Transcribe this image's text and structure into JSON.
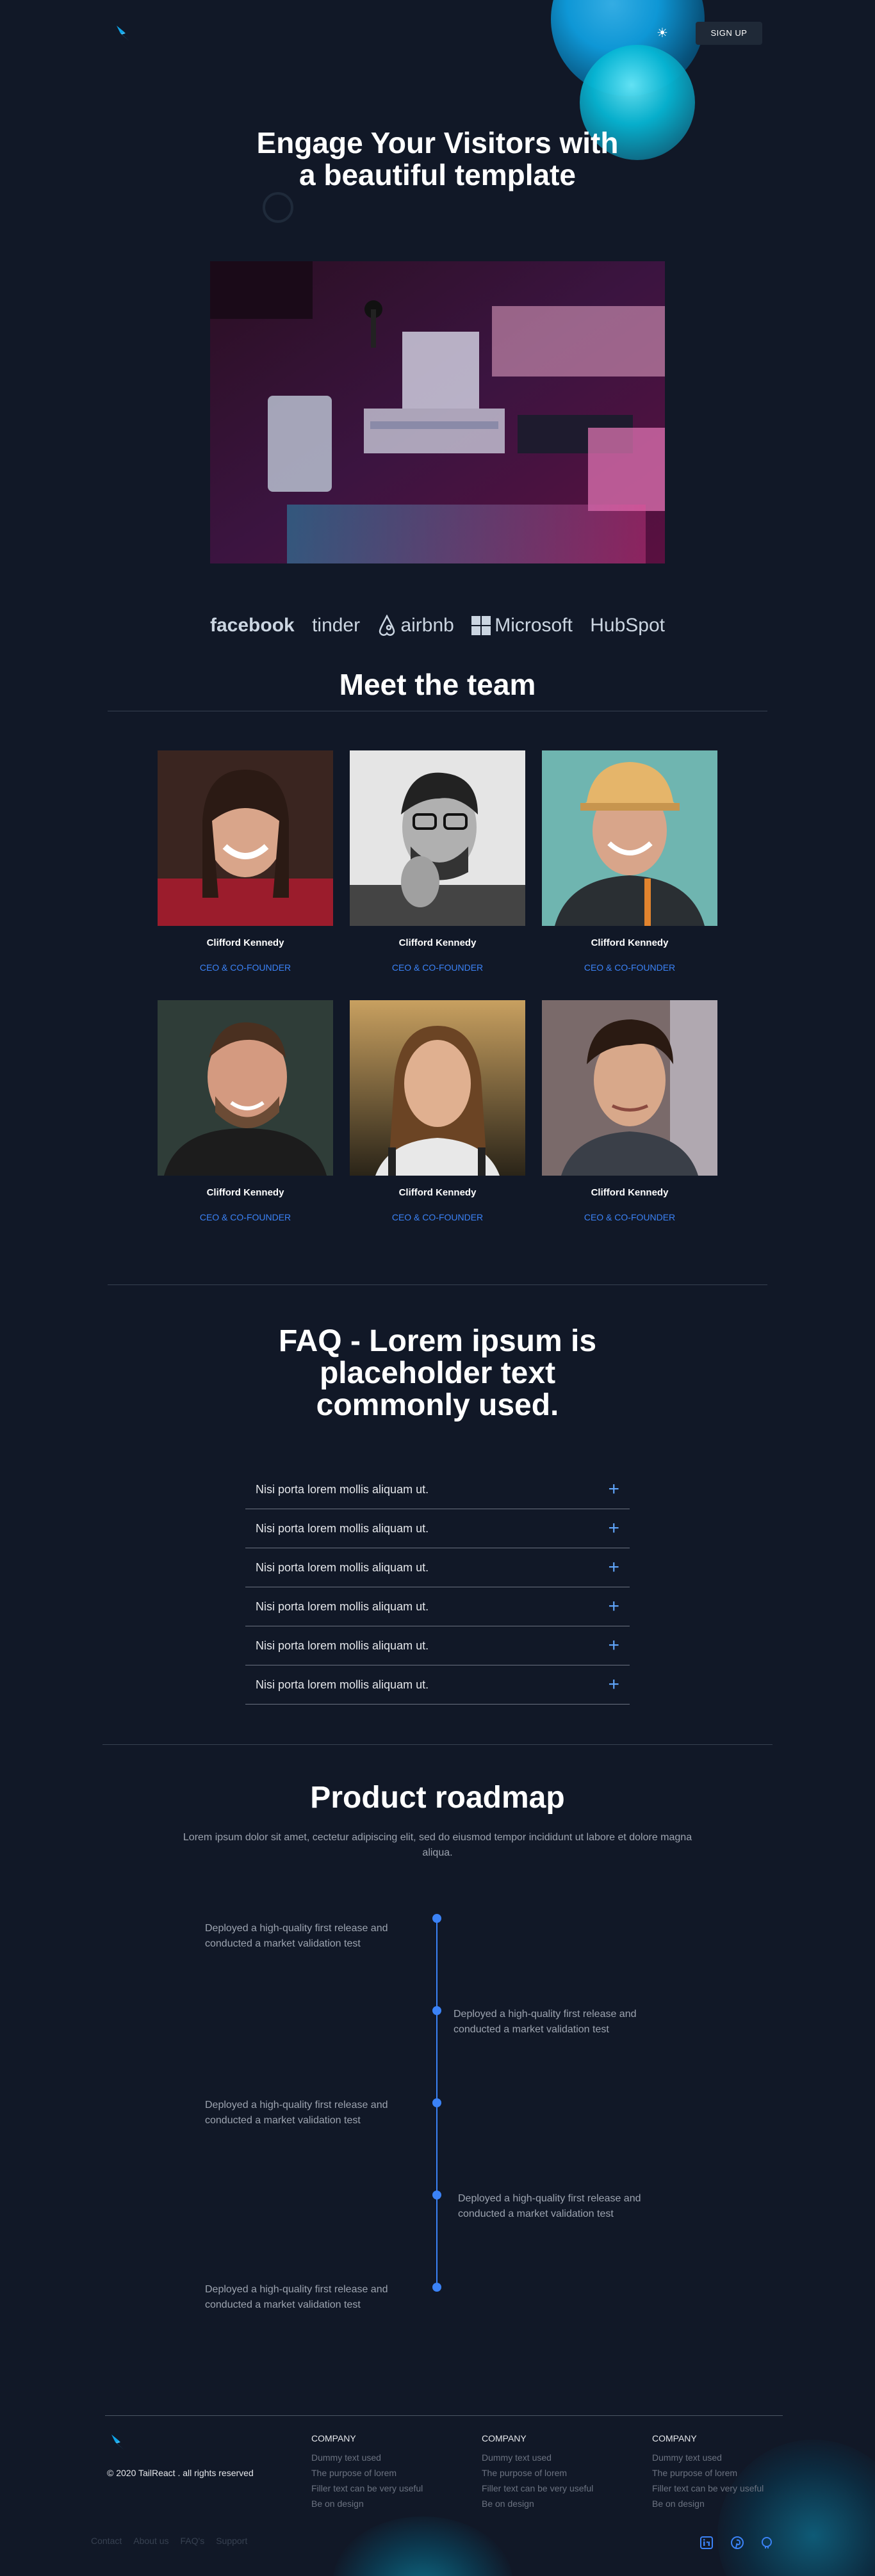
{
  "header": {
    "signup_label": "SIGN UP",
    "theme_icon": "sun-icon"
  },
  "hero": {
    "title": "Engage Your Visitors with a beautiful template"
  },
  "logos": [
    "facebook",
    "tinder",
    "airbnb",
    "Microsoft",
    "HubSpot"
  ],
  "team": {
    "title": "Meet the team",
    "members": [
      {
        "name": "Clifford Kennedy",
        "role": "CEO & CO-FOUNDER"
      },
      {
        "name": "Clifford Kennedy",
        "role": "CEO & CO-FOUNDER"
      },
      {
        "name": "Clifford Kennedy",
        "role": "CEO & CO-FOUNDER"
      },
      {
        "name": "Clifford Kennedy",
        "role": "CEO & CO-FOUNDER"
      },
      {
        "name": "Clifford Kennedy",
        "role": "CEO & CO-FOUNDER"
      },
      {
        "name": "Clifford Kennedy",
        "role": "CEO & CO-FOUNDER"
      }
    ]
  },
  "faq": {
    "title": "FAQ - Lorem ipsum is placeholder text commonly used.",
    "items": [
      "Nisi porta lorem mollis aliquam ut.",
      "Nisi porta lorem mollis aliquam ut.",
      "Nisi porta lorem mollis aliquam ut.",
      "Nisi porta lorem mollis aliquam ut.",
      "Nisi porta lorem mollis aliquam ut.",
      "Nisi porta lorem mollis aliquam ut."
    ]
  },
  "roadmap": {
    "title": "Product roadmap",
    "subtitle": "Lorem ipsum dolor sit amet, cectetur adipiscing elit, sed do eiusmod tempor incididunt ut labore et dolore magna aliqua.",
    "items": [
      "Deployed a high-quality first release and conducted a market validation test",
      "Deployed a high-quality first release and conducted a market validation test",
      "Deployed a high-quality first release and conducted a market validation test",
      "Deployed a high-quality first release and conducted a market validation test",
      "Deployed a high-quality first release and conducted a market validation test"
    ]
  },
  "footer": {
    "copyright": "© 2020 TailReact . all rights reserved",
    "columns": [
      {
        "heading": "COMPANY",
        "links": [
          "Dummy text used",
          "The purpose of lorem",
          "Filler text can be very useful",
          "Be on design"
        ]
      },
      {
        "heading": "COMPANY",
        "links": [
          "Dummy text used",
          "The purpose of lorem",
          "Filler text can be very useful",
          "Be on design"
        ]
      },
      {
        "heading": "COMPANY",
        "links": [
          "Dummy text used",
          "The purpose of lorem",
          "Filler text can be very useful",
          "Be on design"
        ]
      }
    ],
    "bottom_links": [
      "Contact",
      "About us",
      "FAQ's",
      "Support"
    ],
    "social_icons": [
      "linkedin-icon",
      "pinterest-icon",
      "github-icon"
    ]
  },
  "colors": {
    "background": "#111827",
    "accent": "#3b82f6",
    "signup_bg": "#1f2937"
  }
}
